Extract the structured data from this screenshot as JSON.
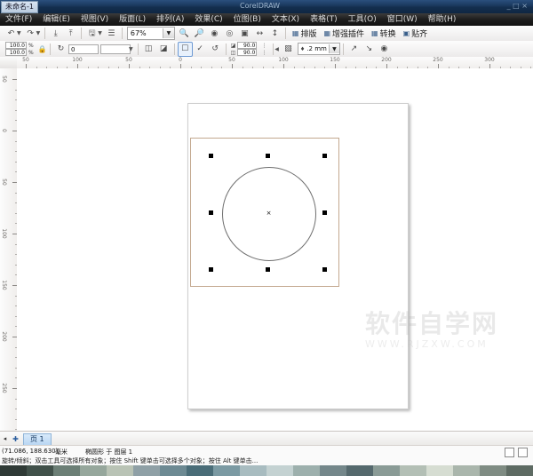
{
  "window": {
    "document_title": "未命名-1",
    "center_caption": "CorelDRAW",
    "right_caption": "_ □ ×"
  },
  "menu": {
    "items": [
      {
        "label": "文件(F)",
        "name": "menu-file"
      },
      {
        "label": "编辑(E)",
        "name": "menu-edit"
      },
      {
        "label": "视图(V)",
        "name": "menu-view"
      },
      {
        "label": "版面(L)",
        "name": "menu-layout"
      },
      {
        "label": "排列(A)",
        "name": "menu-arrange"
      },
      {
        "label": "效果(C)",
        "name": "menu-effects"
      },
      {
        "label": "位图(B)",
        "name": "menu-bitmap"
      },
      {
        "label": "文本(X)",
        "name": "menu-text"
      },
      {
        "label": "表格(T)",
        "name": "menu-table"
      },
      {
        "label": "工具(O)",
        "name": "menu-tools"
      },
      {
        "label": "窗口(W)",
        "name": "menu-window"
      },
      {
        "label": "帮助(H)",
        "name": "menu-help"
      }
    ]
  },
  "toolbar": {
    "undo_icon": "undo-icon",
    "redo_icon": "redo-icon",
    "import_icon": "import-icon",
    "export_icon": "export-icon",
    "publish_icon": "publish-pdf-icon",
    "launch_icon": "application-launcher-icon",
    "zoom_level": "67%",
    "zoom_in_icon": "zoom-in-icon",
    "zoom_out_icon": "zoom-out-icon",
    "zoom_selected_icon": "zoom-to-selection-icon",
    "zoom_all_icon": "zoom-to-all-icon",
    "zoom_page_icon": "zoom-to-page-icon",
    "zoom_width_icon": "zoom-to-width-icon",
    "zoom_height_icon": "zoom-to-height-icon",
    "plugins": [
      {
        "label": "排版",
        "name": "toolbar-plugin-typeset"
      },
      {
        "label": "增强插件",
        "name": "toolbar-plugin-enhanced"
      },
      {
        "label": "转换",
        "name": "toolbar-plugin-convert"
      },
      {
        "label": "贴齐",
        "name": "toolbar-plugin-snap"
      }
    ]
  },
  "property_bar": {
    "scale_x": "100.0",
    "scale_y": "100.0",
    "scale_unit_x": "%",
    "scale_unit_y": "%",
    "lock_ratio_icon": "lock-ratio-icon",
    "rotation_angle": "0",
    "rotation_blank": "",
    "mirror_h_icon": "mirror-horizontal-icon",
    "mirror_v_icon": "mirror-vertical-icon",
    "to_curves_icon": "convert-to-curves-icon",
    "wrap_text_icon": "wrap-paragraph-text-icon",
    "rotate_cw_icon": "rotate-icon",
    "skew_x": "90.0",
    "skew_y": "90.0",
    "nudge_icon_a": "nudge-offset-icon",
    "nudge_icon_b": "nudge-offset-icon",
    "outline_picker_icon": "outline-color-icon",
    "outline_width": ".2 mm",
    "outline_dash_icon": "outline-style-icon",
    "arrow_icon": "arrowhead-icon",
    "target_icon": "target-icon"
  },
  "rulers": {
    "unit": "毫米",
    "h_labels": [
      "50",
      "100",
      "50",
      "0",
      "50",
      "100",
      "150",
      "200",
      "250",
      "300"
    ],
    "v_labels": [
      "50",
      "0",
      "50",
      "100",
      "150",
      "200",
      "250"
    ]
  },
  "canvas": {
    "page_name": "drawing-page",
    "square_object": "rectangle-object",
    "ellipse_object": "ellipse-object",
    "handles": 8,
    "center_marker": "×",
    "watermark_main": "软件自学网",
    "watermark_sub": "WWW.RJZXW.COM"
  },
  "page_bar": {
    "first_icon": "first-page-icon",
    "prev_icon": "previous-page-icon",
    "add_icon": "add-page-icon",
    "tab_label": "页 1"
  },
  "status_bar": {
    "coordinates": "(71.086, 188.630)",
    "unit": "毫米",
    "object_info": "椭圆形 于 图层 1",
    "hint": "旋转/倾斜；双击工具可选择所有对象；按住 Shift 键单击可选择多个对象；按住 Alt 键单击...",
    "fill_label": "",
    "outline_label": ""
  },
  "palette": {
    "colors": [
      "#2f3a36",
      "#41514a",
      "#6c7f76",
      "#96a79c",
      "#b9c3b5",
      "#8fa0a6",
      "#6d8a93",
      "#4a6d78",
      "#7b9aa3",
      "#a8bcc0",
      "#c4d2d2",
      "#9db0ad",
      "#74878a",
      "#55696d",
      "#8a9b96",
      "#b3bfb5",
      "#d6ddd2",
      "#aab6ac",
      "#7f8c83",
      "#5e6b63"
    ]
  }
}
